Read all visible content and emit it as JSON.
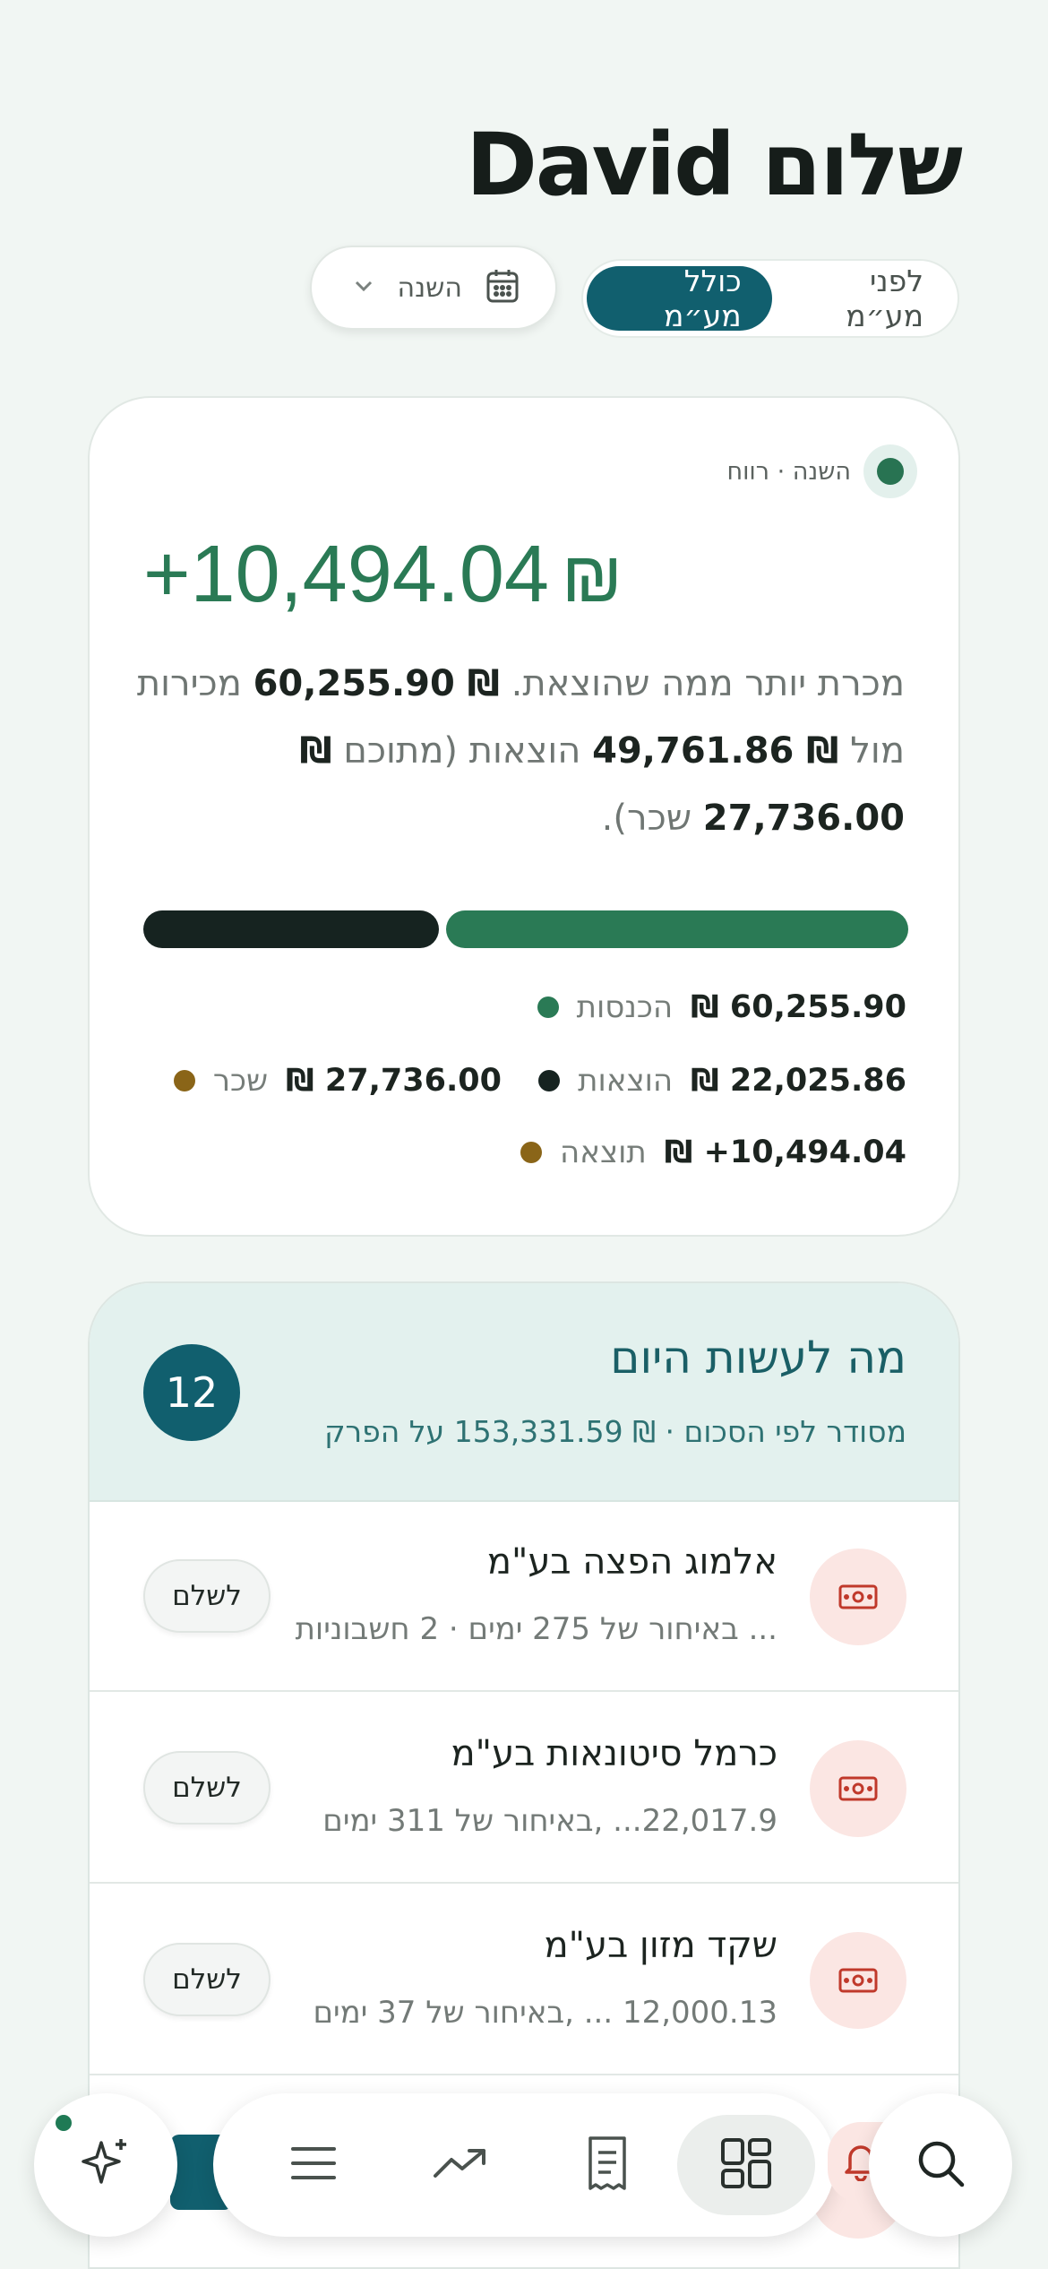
{
  "header": {
    "greeting": "שלום David"
  },
  "vat_toggle": {
    "before": "לפני מע״מ",
    "including": "כולל מע״מ"
  },
  "period": {
    "label": "השנה"
  },
  "profit_card": {
    "badge": "השנה · רווח",
    "amount": "+10,494.04",
    "currency": "₪",
    "desc_1": "מכרת יותר ממה שהוצאת.",
    "sales_val": "₪ 60,255.90",
    "desc_2": "מכירות מול",
    "expenses_val": "₪ 49,761.86",
    "desc_3": "הוצאות (מתוכם",
    "salary_val": "₪ 27,736.00",
    "desc_4": "שכר).",
    "legend": {
      "income_label": "הכנסות",
      "income_val": "₪ 60,255.90",
      "expenses_label": "הוצאות",
      "expenses_val": "₪ 22,025.86",
      "salary_label": "שכר",
      "salary_val": "₪ 27,736.00",
      "result_label": "תוצאה",
      "result_val": "₪ +10,494.04"
    },
    "progress": {
      "income_share": 0.61
    },
    "colors": {
      "income": "#2a7a55",
      "expenses": "#162320",
      "salary": "#8a6518",
      "result": "#8a6518"
    }
  },
  "todo": {
    "title": "מה לעשות היום",
    "subtitle": "מסודר לפי הסכום · ₪ 153,331.59 על הפרק",
    "count": "12",
    "rows": [
      {
        "name": "אלמוג הפצה בע\"מ",
        "meta": "... באיחור של 275 ימים · 2 חשבוניות",
        "action": "לשלם"
      },
      {
        "name": "כרמל סיטונאות בע\"מ",
        "meta": "22,017.9... ,באיחור של 311 ימים",
        "action": "לשלם"
      },
      {
        "name": "שקד מזון בע\"מ",
        "meta": "12,000.13 ... ,באיחור של 37 ימים",
        "action": "לשלם"
      }
    ]
  },
  "nav": {
    "icons": [
      "sparkle-icon",
      "list-icon",
      "trend-icon",
      "receipt-icon",
      "dashboard-icon",
      "bell-icon",
      "search-icon"
    ]
  }
}
